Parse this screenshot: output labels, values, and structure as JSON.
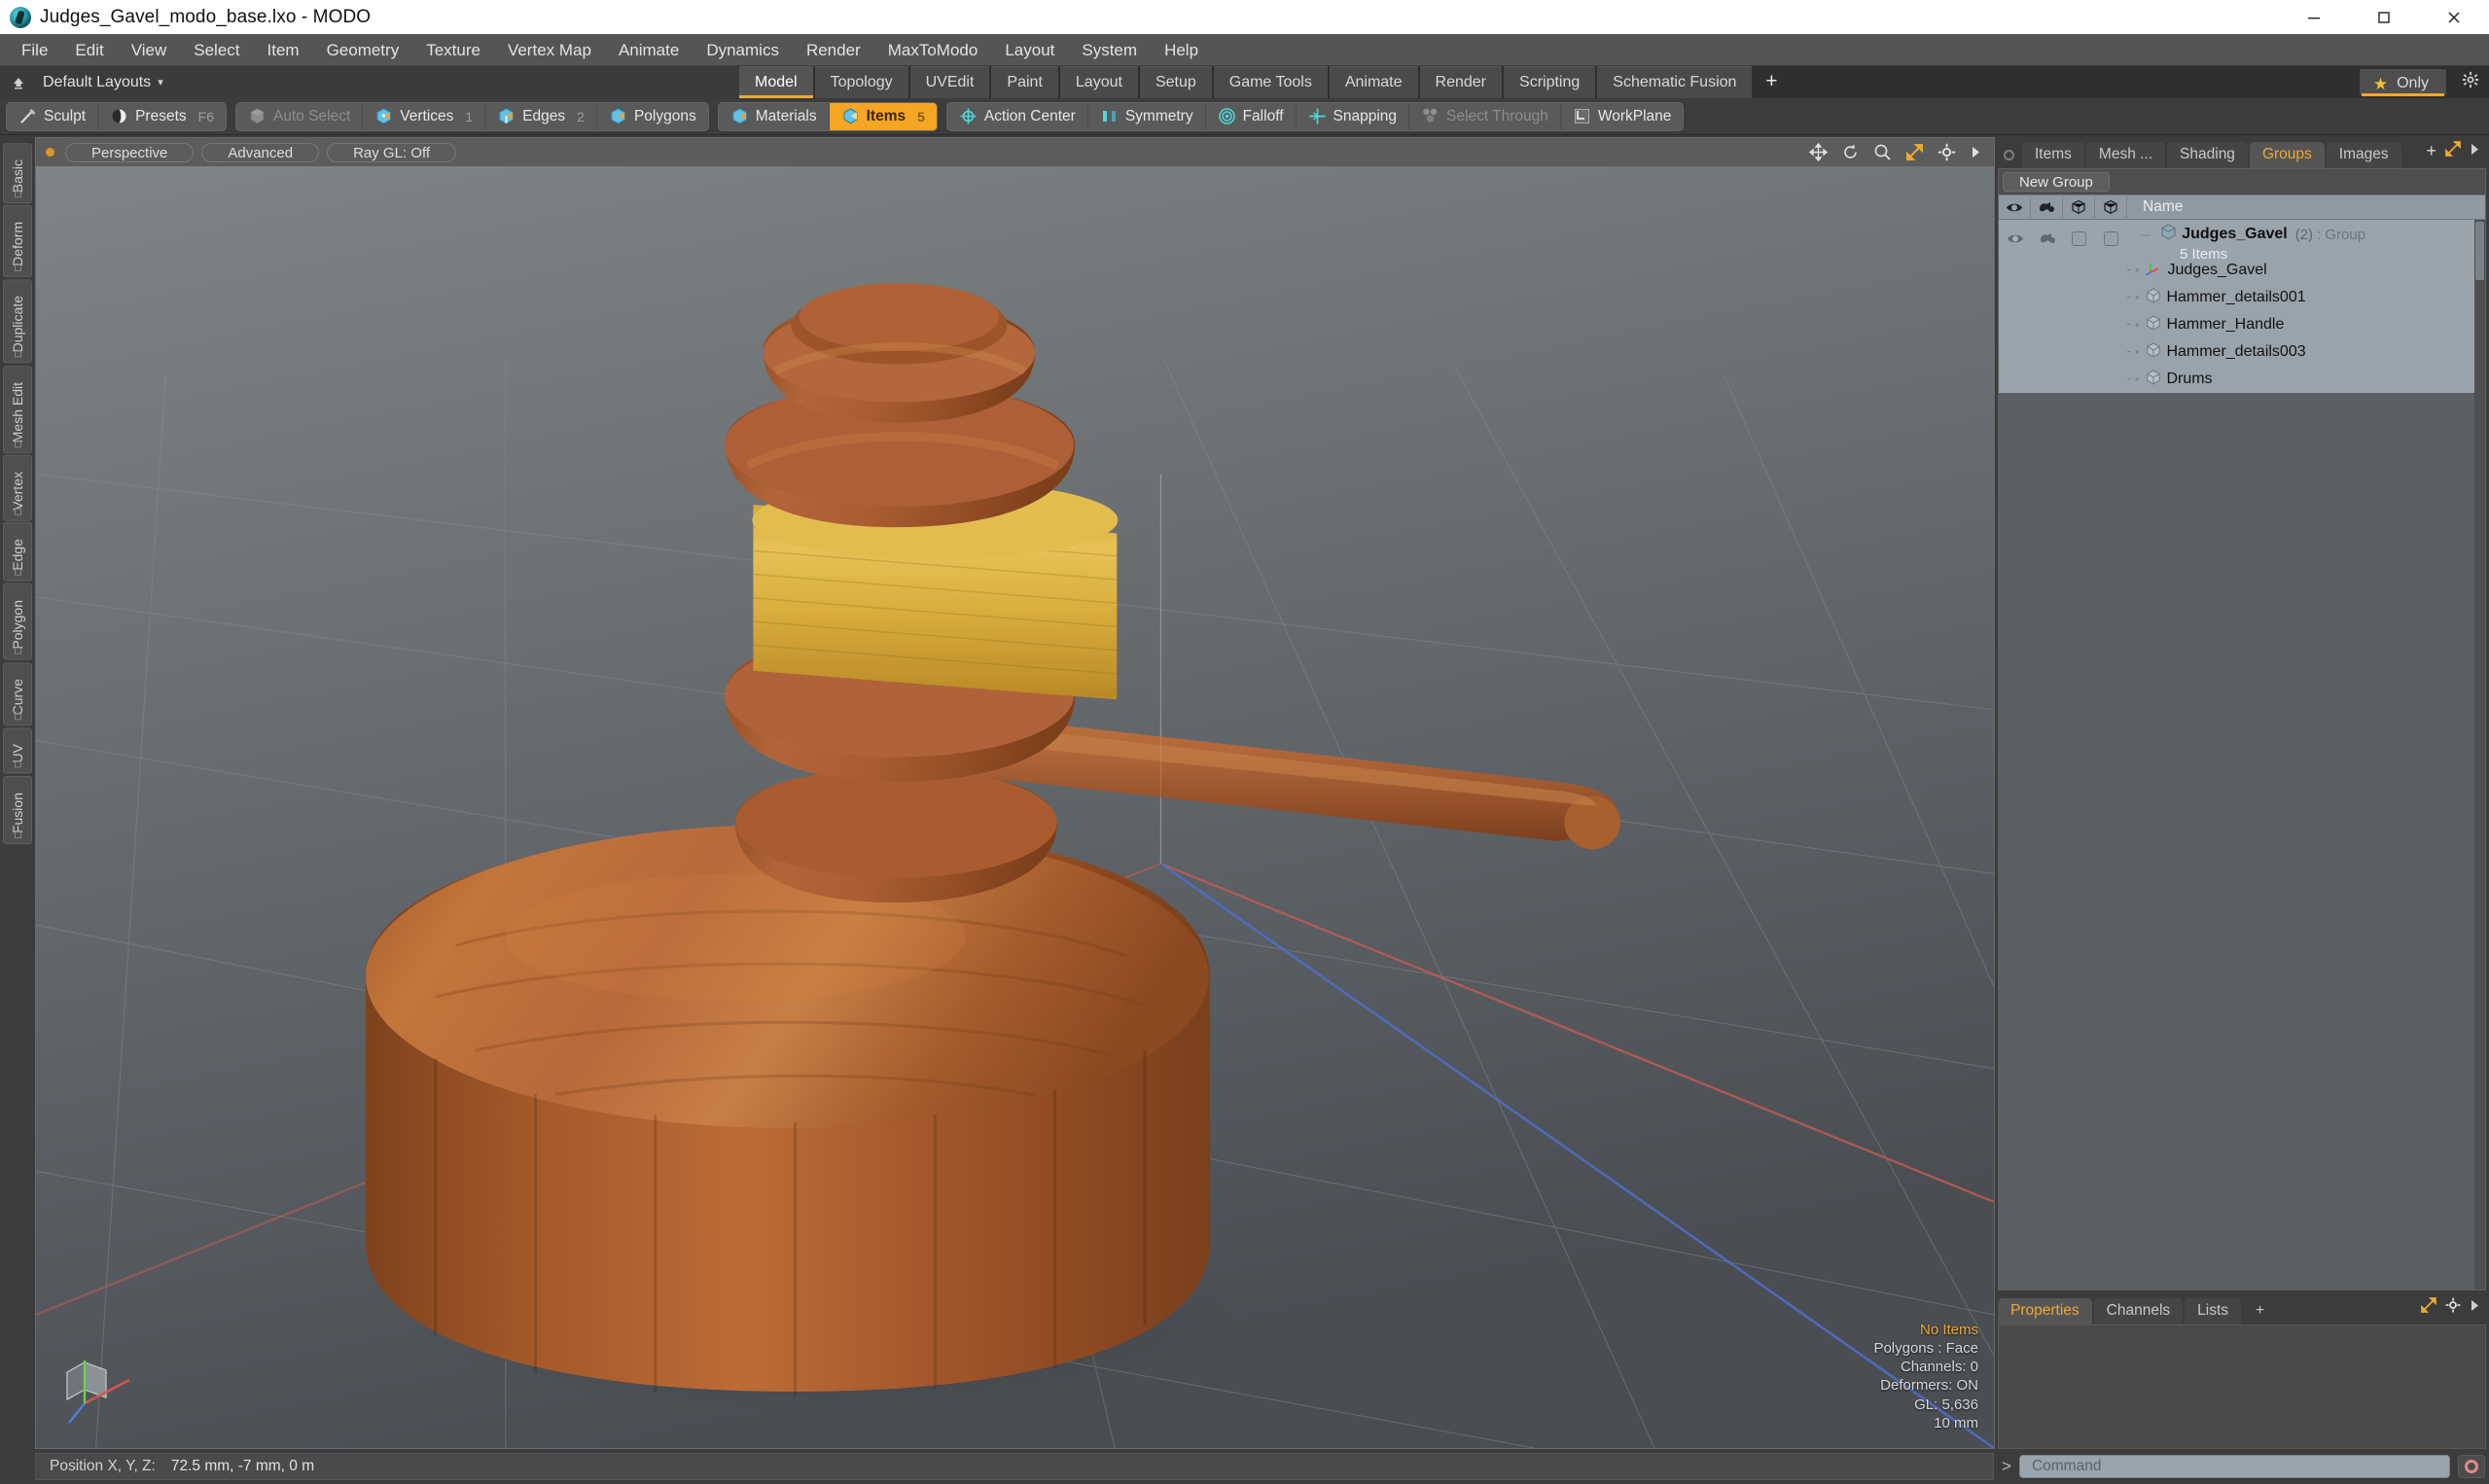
{
  "window": {
    "title": "Judges_Gavel_modo_base.lxo - MODO",
    "app_icon": "modo-logo-icon",
    "minimize": "minimize-icon",
    "maximize": "maximize-icon",
    "close": "close-icon"
  },
  "menubar": {
    "items": [
      "File",
      "Edit",
      "View",
      "Select",
      "Item",
      "Geometry",
      "Texture",
      "Vertex Map",
      "Animate",
      "Dynamics",
      "Render",
      "MaxToModo",
      "Layout",
      "System",
      "Help"
    ]
  },
  "layout_row": {
    "presets_label": "Default Layouts",
    "caret": "▾",
    "tabs": [
      {
        "label": "Model",
        "active": true
      },
      {
        "label": "Topology",
        "active": false
      },
      {
        "label": "UVEdit",
        "active": false
      },
      {
        "label": "Paint",
        "active": false
      },
      {
        "label": "Layout",
        "active": false
      },
      {
        "label": "Setup",
        "active": false
      },
      {
        "label": "Game Tools",
        "active": false
      },
      {
        "label": "Animate",
        "active": false
      },
      {
        "label": "Render",
        "active": false
      },
      {
        "label": "Scripting",
        "active": false
      },
      {
        "label": "Schematic Fusion",
        "active": false
      }
    ],
    "add_tab": "+",
    "only_button": {
      "label": "Only",
      "star": "★"
    },
    "gear": "gear-icon"
  },
  "toolbar": {
    "groups": [
      {
        "buttons": [
          {
            "label": "Sculpt",
            "icon": "sculpt-icon",
            "state": "normal",
            "badge": ""
          },
          {
            "label": "Presets",
            "icon": "presets-icon",
            "state": "normal",
            "badge": "F6"
          }
        ]
      },
      {
        "buttons": [
          {
            "label": "Auto Select",
            "icon": "cube-gray-icon",
            "state": "dim",
            "badge": ""
          },
          {
            "label": "Vertices",
            "icon": "vertices-icon",
            "state": "normal",
            "badge": "1"
          },
          {
            "label": "Edges",
            "icon": "edges-icon",
            "state": "normal",
            "badge": "2"
          },
          {
            "label": "Polygons",
            "icon": "polygons-icon",
            "state": "normal",
            "badge": ""
          }
        ]
      },
      {
        "buttons": [
          {
            "label": "Materials",
            "icon": "materials-icon",
            "state": "normal",
            "badge": ""
          },
          {
            "label": "Items",
            "icon": "items-icon",
            "state": "active",
            "badge": "5"
          }
        ]
      },
      {
        "buttons": [
          {
            "label": "Action Center",
            "icon": "action-center-icon",
            "state": "normal",
            "badge": ""
          },
          {
            "label": "Symmetry",
            "icon": "symmetry-icon",
            "state": "normal",
            "badge": ""
          },
          {
            "label": "Falloff",
            "icon": "falloff-icon",
            "state": "normal",
            "badge": ""
          },
          {
            "label": "Snapping",
            "icon": "snapping-icon",
            "state": "normal",
            "badge": ""
          },
          {
            "label": "Select Through",
            "icon": "select-through-icon",
            "state": "dim",
            "badge": ""
          },
          {
            "label": "WorkPlane",
            "icon": "workplane-icon",
            "state": "normal",
            "badge": ""
          }
        ]
      }
    ]
  },
  "left_tabs": [
    "Basic",
    "Deform",
    "Duplicate",
    "Mesh Edit",
    "Vertex",
    "Edge",
    "Polygon",
    "Curve",
    "UV",
    "Fusion"
  ],
  "viewport": {
    "header": {
      "pills": [
        "Perspective",
        "Advanced",
        "Ray GL: Off"
      ],
      "icons": [
        "move-icon",
        "rotate-icon",
        "zoom-icon",
        "fit-icon",
        "gear-icon",
        "chevron-right-icon"
      ]
    },
    "stats": {
      "selection": "No Items",
      "polygons": "Polygons : Face",
      "channels": "Channels: 0",
      "deformers": "Deformers: ON",
      "gl": "GL: 5,636",
      "grid": "10 mm"
    },
    "axis_colors": {
      "x": "#d4564f",
      "y": "#6ad14e",
      "z": "#4f7fd4"
    }
  },
  "right_panel": {
    "tabs": [
      {
        "label": "Items",
        "active": false
      },
      {
        "label": "Mesh ...",
        "active": false
      },
      {
        "label": "Shading",
        "active": false
      },
      {
        "label": "Groups",
        "active": true
      },
      {
        "label": "Images",
        "active": false
      }
    ],
    "add_tab": "+",
    "tools": [
      "expand-icon",
      "chevron-right-icon"
    ],
    "new_group_button": "New Group",
    "list_headers": {
      "eye": "visibility-icon",
      "render": "render-icon",
      "lock": "lock-cube-icon",
      "select": "select-cube-icon",
      "name": "Name"
    },
    "group": {
      "name": "Judges_Gavel",
      "count": "(2)",
      "type": ": Group",
      "items_label": "5 Items"
    },
    "children": [
      {
        "label": "Judges_Gavel",
        "icon": "locator-axis-icon"
      },
      {
        "label": "Hammer_details001",
        "icon": "mesh-cube-icon"
      },
      {
        "label": "Hammer_Handle",
        "icon": "mesh-cube-icon"
      },
      {
        "label": "Hammer_details003",
        "icon": "mesh-cube-icon"
      },
      {
        "label": "Drums",
        "icon": "mesh-cube-icon"
      }
    ]
  },
  "bottom_panel": {
    "tabs": [
      {
        "label": "Properties",
        "active": true
      },
      {
        "label": "Channels",
        "active": false
      },
      {
        "label": "Lists",
        "active": false
      }
    ],
    "add_tab": "+",
    "tools": [
      "expand-icon",
      "gear-icon",
      "chevron-right-icon"
    ]
  },
  "statusbar": {
    "position_label": "Position X, Y, Z:",
    "position_value": "72.5 mm, -7 mm, 0 m",
    "command_prompt": ">",
    "command_placeholder": "Command",
    "record_icon": "record-icon"
  },
  "colors": {
    "accent": "#f0a830",
    "active_tool": "#f5a623",
    "panel": "#555555",
    "chrome": "#3c3c3c",
    "menubar": "#555555",
    "list_row": "#99a3ac",
    "list_header": "#8f9aa3"
  }
}
